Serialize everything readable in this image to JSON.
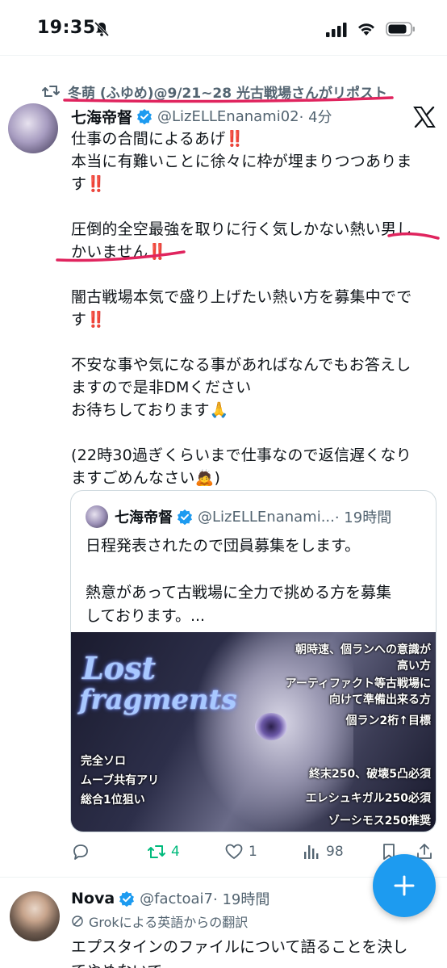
{
  "status_bar": {
    "time": "19:35"
  },
  "retweet_header": {
    "text": "冬萌 (ふゆめ)@9/21~28 光古戦場さんがリポスト"
  },
  "tweet": {
    "author_name": "七海帝督",
    "author_handle": "@LizELLEnanami02",
    "time": "· 4分",
    "lines": [
      "仕事の合間によるあげ‼️",
      "本当に有難いことに徐々に枠が埋まりつつありま",
      "す‼️",
      "",
      "圧倒的全空最強を取りに行く気しかない熱い男し",
      "かいません‼️",
      "",
      "闇古戦場本気で盛り上げたい熱い方を募集中でで",
      "す‼️",
      "",
      "不安な事や気になる事があればなんでもお答えし",
      "ますので是非DMください",
      "お待ちしております🙏",
      "",
      "(22時30過ぎくらいまで仕事なので返信遅くなり",
      "ますごめんなさい🙇)"
    ]
  },
  "quote": {
    "author_name": "七海帝督",
    "author_handle": "@LizELLEnanami...",
    "time": "· 19時間",
    "lines": [
      "日程発表されたので団員募集をします。",
      "",
      "熱意があって古戦場に全力で挑める方を募集",
      "しております。..."
    ],
    "image": {
      "logo_line1": "Lost",
      "logo_line2": "fragments",
      "right_texts": [
        "朝時速、個ランへの意識が",
        "高い方",
        "アーティファクト等古戦場に",
        "向けて準備出来る方",
        "個ラン2桁↑目標"
      ],
      "left_texts": [
        "完全ソロ",
        "ムーブ共有アリ",
        "総合1位狙い"
      ],
      "bottom_right_texts": [
        "終末250、破壊5凸必須",
        "エレシュキガル250必須",
        "ゾーシモス250推奨"
      ]
    }
  },
  "actions": {
    "reposts": "4",
    "likes": "1",
    "views": "98"
  },
  "next_tweet": {
    "author_name": "Nova",
    "author_handle": "@factoai7",
    "time": "· 19時間",
    "translation_note": "Grokによる英語からの翻訳",
    "lines": [
      "エプスタインのファイルについて語ることを決し",
      "てやめないで"
    ]
  },
  "colors": {
    "accent": "#1d9bf0",
    "retweet_green": "#00ba7c",
    "muted": "#536471",
    "underline_red": "#e0245e"
  }
}
